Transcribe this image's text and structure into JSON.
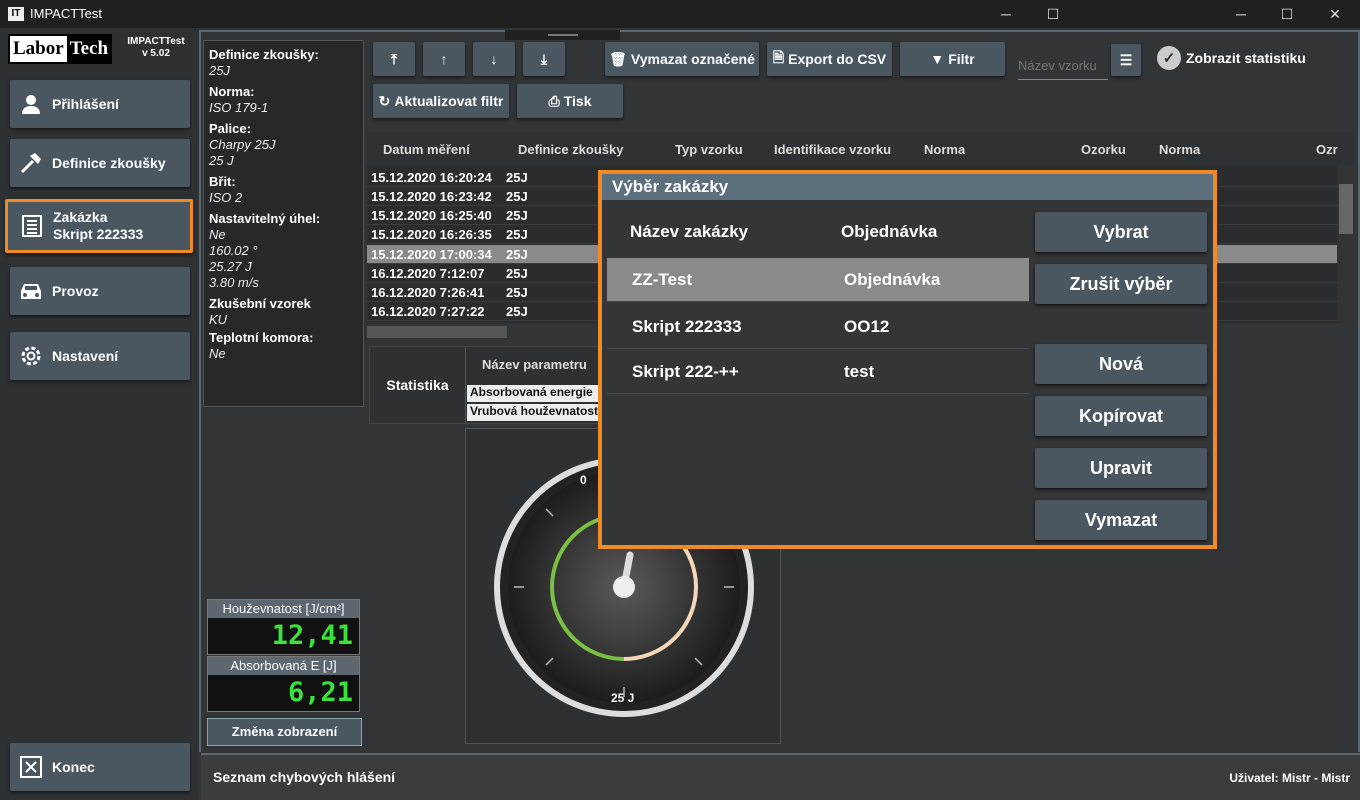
{
  "window": {
    "title": "IMPACTTest",
    "app_icon": "IT"
  },
  "sidebar": {
    "logo_left": "Labor",
    "logo_right": "Tech",
    "app_name": "IMPACTTest",
    "version": "v 5.02",
    "items": [
      {
        "label": "Přihlášení",
        "icon": "user-icon"
      },
      {
        "label": "Definice zkoušky",
        "icon": "hammer-icon"
      },
      {
        "label": "Zakázka",
        "sublabel": "Skript 222333",
        "icon": "document-icon"
      },
      {
        "label": "Provoz",
        "icon": "car-icon"
      },
      {
        "label": "Nastavení",
        "icon": "gear-icon"
      }
    ],
    "exit_label": "Konec"
  },
  "info": {
    "definice_k": "Definice zkoušky:",
    "definice_v": "25J",
    "norma_k": "Norma:",
    "norma_v": "ISO 179-1",
    "palice_k": "Palice:",
    "palice_v1": "Charpy 25J",
    "palice_v2": "25 J",
    "brit_k": "Břit:",
    "brit_v": "ISO 2",
    "uhel_k": "Nastavitelný úhel:",
    "uhel_v1": "Ne",
    "uhel_v2": "160.02 °",
    "uhel_v3": "25.27 J",
    "uhel_v4": "3.80 m/s",
    "vzorek_k": "Zkušební vzorek",
    "vzorek_v": "KU",
    "komora_k": "Teplotní komora:",
    "komora_v": "Ne"
  },
  "meters": {
    "toughness_label": "Houževnatost [J/cm²]",
    "toughness_value": "12,41",
    "energy_label": "Absorbovaná E [J]",
    "energy_value": "6,21",
    "change_view": "Změna zobrazení"
  },
  "toolbar": {
    "delete_marked": "Vymazat označené",
    "export_csv": "Export do CSV",
    "filter": "Filtr",
    "filter_placeholder": "Název vzorku",
    "show_stats": "Zobrazit statistiku",
    "refresh_filter": "Aktualizovat filtr",
    "print": "Tisk"
  },
  "table": {
    "columns": [
      "Datum měření",
      "Definice zkoušky",
      "Typ vzorku",
      "Identifikace vzorku",
      "Norma",
      "Ozorku",
      "Norma",
      "Ozr"
    ],
    "rows": [
      {
        "date": "15.12.2020 16:20:24",
        "def": "25J"
      },
      {
        "date": "15.12.2020 16:23:42",
        "def": "25J"
      },
      {
        "date": "15.12.2020 16:25:40",
        "def": "25J"
      },
      {
        "date": "15.12.2020 16:26:35",
        "def": "25J"
      },
      {
        "date": "15.12.2020 17:00:34",
        "def": "25J"
      },
      {
        "date": "16.12.2020 7:12:07",
        "def": "25J"
      },
      {
        "date": "16.12.2020 7:26:41",
        "def": "25J"
      },
      {
        "date": "16.12.2020 7:27:22",
        "def": "25J"
      }
    ]
  },
  "stats": {
    "title": "Statistika",
    "param_header": "Název parametru",
    "params": [
      "Absorbovaná energie",
      "Vrubová houževnatost"
    ]
  },
  "gauge": {
    "zero_label": "0",
    "max_label": "25 J",
    "value_fraction": 0.25
  },
  "footer": {
    "errors": "Seznam chybových hlášení",
    "user": "Uživatel:  Mistr  -  Mistr"
  },
  "dialog": {
    "title": "Výběr zakázky",
    "col_name": "Název zakázky",
    "col_order": "Objednávka",
    "rows": [
      {
        "name": "ZZ-Test",
        "order": "Objednávka"
      },
      {
        "name": "Skript 222333",
        "order": "OO12"
      },
      {
        "name": "Skript 222-++",
        "order": "test"
      }
    ],
    "buttons": {
      "select": "Vybrat",
      "cancel_select": "Zrušit výběr",
      "new": "Nová",
      "copy": "Kopírovat",
      "edit": "Upravit",
      "delete": "Vymazat"
    }
  },
  "colors": {
    "accent": "#f08a24",
    "button": "#4a5761",
    "meter_green": "#3ae23a",
    "selection": "#8a8a8a"
  }
}
